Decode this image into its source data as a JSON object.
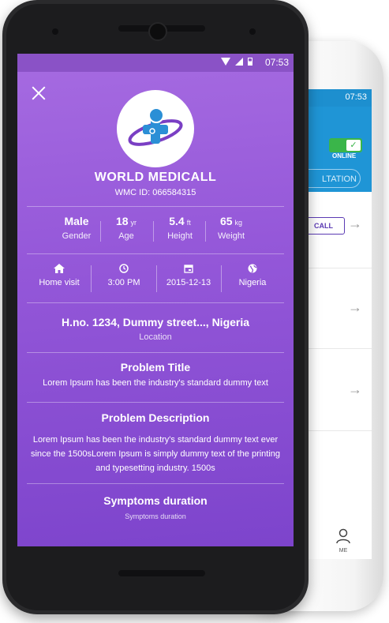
{
  "back_phone": {
    "status_time": "07:53",
    "online_label": "ONLINE",
    "consult_label": "LTATION",
    "call_label": "CALL",
    "nav_me": "ME"
  },
  "status_bar": {
    "time": "07:53"
  },
  "doctor": {
    "name": "WORLD MEDICALL",
    "wmc_id": "WMC ID: 066584315"
  },
  "stats": [
    {
      "value": "Male",
      "unit": "",
      "label": "Gender"
    },
    {
      "value": "18",
      "unit": "yr",
      "label": "Age"
    },
    {
      "value": "5.4",
      "unit": "ft",
      "label": "Height"
    },
    {
      "value": "65",
      "unit": "kg",
      "label": "Weight"
    }
  ],
  "info": [
    {
      "icon": "home-icon",
      "label": "Home visit"
    },
    {
      "icon": "clock-icon",
      "label": "3:00 PM"
    },
    {
      "icon": "calendar-icon",
      "label": "2015-12-13"
    },
    {
      "icon": "globe-icon",
      "label": "Nigeria"
    }
  ],
  "address": {
    "value": "H.no. 1234, Dummy street..., Nigeria",
    "label": "Location"
  },
  "problem_title": {
    "heading": "Problem Title",
    "body": "Lorem Ipsum has been the industry's standard dummy text"
  },
  "problem_description": {
    "heading": "Problem Description",
    "body": "Lorem Ipsum has been the industry's standard dummy text ever since the 1500sLorem Ipsum is simply dummy text of the printing and typesetting industry. 1500s"
  },
  "symptoms": {
    "heading": "Symptoms duration",
    "label": "Symptoms duration"
  },
  "colors": {
    "accent_purple": "#9558d9",
    "accent_blue": "#1f95d6",
    "online_green": "#3ab54a"
  }
}
